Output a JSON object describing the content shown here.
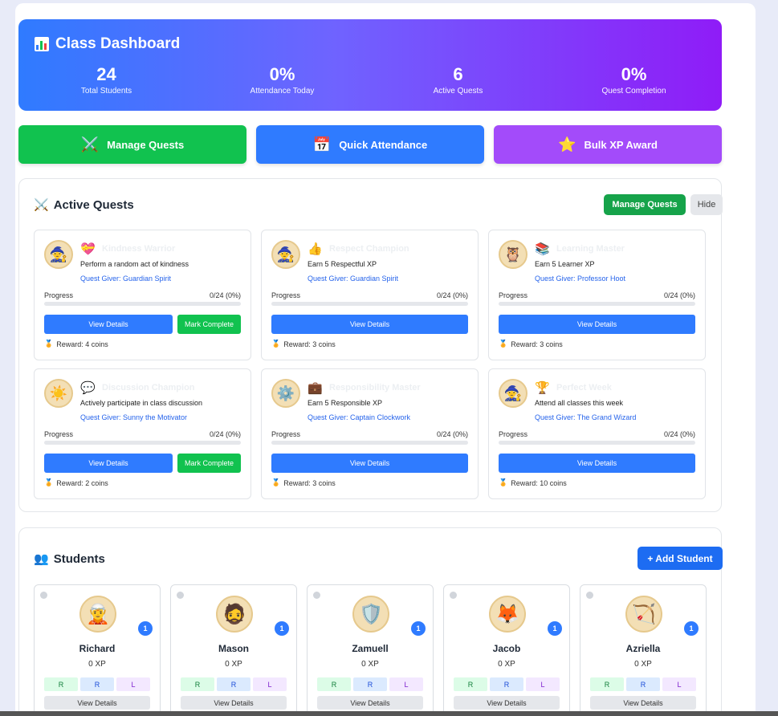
{
  "header": {
    "title": "Class Dashboard",
    "icon": "bar-chart-icon",
    "stats": [
      {
        "value": "24",
        "label": "Total Students"
      },
      {
        "value": "0%",
        "label": "Attendance Today"
      },
      {
        "value": "6",
        "label": "Active Quests"
      },
      {
        "value": "0%",
        "label": "Quest Completion"
      }
    ]
  },
  "actions": {
    "manage_quests": "Manage Quests",
    "quick_attendance": "Quick Attendance",
    "bulk_xp": "Bulk XP Award",
    "colors": {
      "green": "#11c24f",
      "blue": "#2f7bff",
      "purple": "#a34bfa"
    }
  },
  "quests_panel": {
    "title": "Active Quests",
    "manage_label": "Manage Quests",
    "hide_label": "Hide",
    "progress_label": "Progress",
    "view_label": "View Details",
    "complete_label": "Mark Complete",
    "quests": [
      {
        "name": "Kindness Warrior",
        "icon": "heart-icon",
        "desc": "Perform a random act of kindness",
        "giver": "Quest Giver: Guardian Spirit",
        "progress": "0/24 (0%)",
        "progress_value": 0,
        "reward": "Reward: 4 coins",
        "can_complete": true
      },
      {
        "name": "Respect Champion",
        "icon": "thumbs-up-icon",
        "desc": "Earn 5 Respectful XP",
        "giver": "Quest Giver: Guardian Spirit",
        "progress": "0/24 (0%)",
        "progress_value": 0,
        "reward": "Reward: 3 coins",
        "can_complete": false
      },
      {
        "name": "Learning Master",
        "icon": "books-icon",
        "desc": "Earn 5 Learner XP",
        "giver": "Quest Giver: Professor Hoot",
        "progress": "0/24 (0%)",
        "progress_value": 0,
        "reward": "Reward: 3 coins",
        "can_complete": false
      },
      {
        "name": "Discussion Champion",
        "icon": "speech-bubble-icon",
        "desc": "Actively participate in class discussion",
        "giver": "Quest Giver: Sunny the Motivator",
        "progress": "0/24 (0%)",
        "progress_value": 0,
        "reward": "Reward: 2 coins",
        "can_complete": true
      },
      {
        "name": "Responsibility Master",
        "icon": "briefcase-icon",
        "desc": "Earn 5 Responsible XP",
        "giver": "Quest Giver: Captain Clockwork",
        "progress": "0/24 (0%)",
        "progress_value": 0,
        "reward": "Reward: 3 coins",
        "can_complete": false
      },
      {
        "name": "Perfect Week",
        "icon": "trophy-icon",
        "desc": "Attend all classes this week",
        "giver": "Quest Giver: The Grand Wizard",
        "progress": "0/24 (0%)",
        "progress_value": 0,
        "reward": "Reward: 10 coins",
        "can_complete": false
      }
    ]
  },
  "students_panel": {
    "title": "Students",
    "add_label": "+ Add Student",
    "view_label": "View Details",
    "students": [
      {
        "name": "Richard",
        "xp": "0 XP",
        "level": "1",
        "tags": [
          "R",
          "R",
          "L"
        ]
      },
      {
        "name": "Mason",
        "xp": "0 XP",
        "level": "1",
        "tags": [
          "R",
          "R",
          "L"
        ]
      },
      {
        "name": "Zamuell",
        "xp": "0 XP",
        "level": "1",
        "tags": [
          "R",
          "R",
          "L"
        ]
      },
      {
        "name": "Jacob",
        "xp": "0 XP",
        "level": "1",
        "tags": [
          "R",
          "R",
          "L"
        ]
      },
      {
        "name": "Azriella",
        "xp": "0 XP",
        "level": "1",
        "tags": [
          "R",
          "R",
          "L"
        ]
      }
    ]
  }
}
